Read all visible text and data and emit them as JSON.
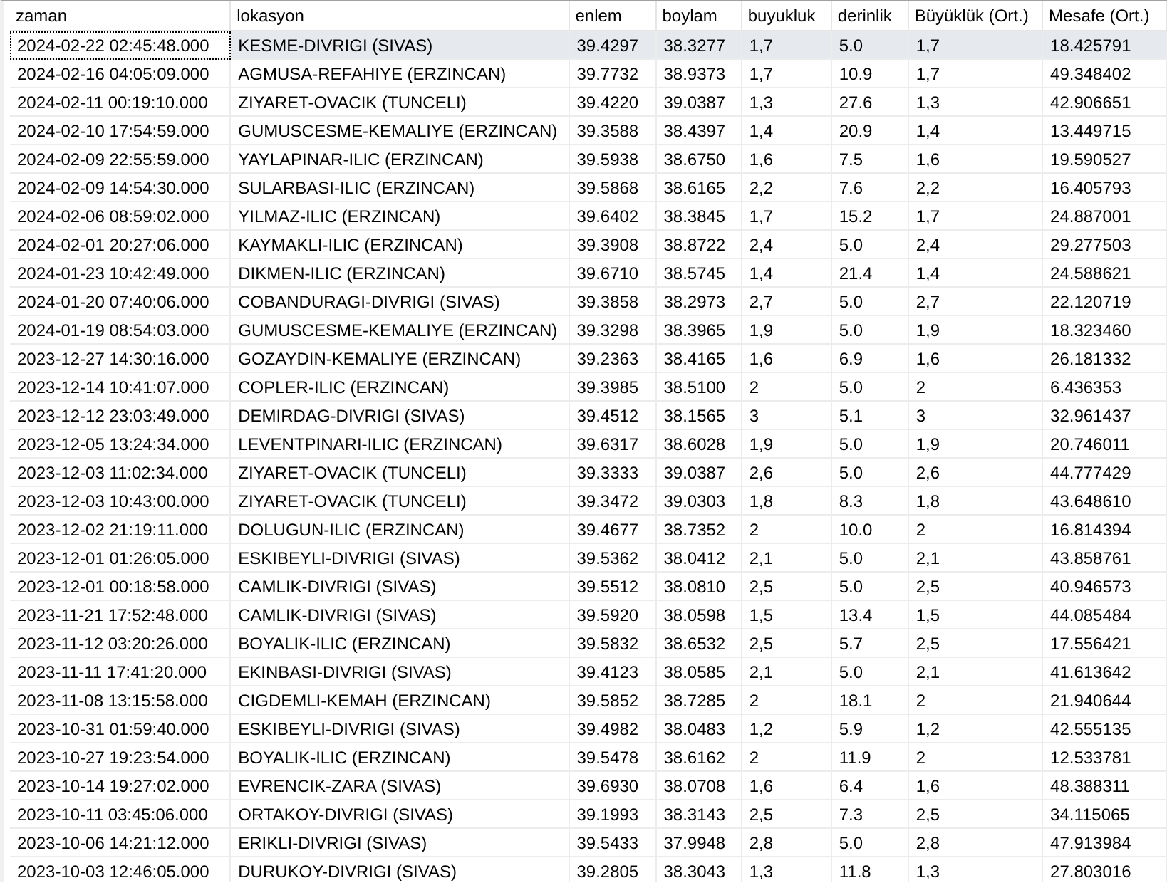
{
  "table": {
    "columns": [
      "zaman",
      "lokasyon",
      "enlem",
      "boylam",
      "buyukluk",
      "derinlik",
      "Büyüklük (Ort.)",
      "Mesafe (Ort.)"
    ],
    "rows": [
      {
        "selected": true,
        "cells": [
          "2024-02-22 02:45:48.000",
          "KESME-DIVRIGI (SIVAS)",
          "39.4297",
          "38.3277",
          "1,7",
          "5.0",
          "1,7",
          "18.425791"
        ]
      },
      {
        "selected": false,
        "cells": [
          "2024-02-16 04:05:09.000",
          "AGMUSA-REFAHIYE (ERZINCAN)",
          "39.7732",
          "38.9373",
          "1,7",
          "10.9",
          "1,7",
          "49.348402"
        ]
      },
      {
        "selected": false,
        "cells": [
          "2024-02-11 00:19:10.000",
          "ZIYARET-OVACIK (TUNCELI)",
          "39.4220",
          "39.0387",
          "1,3",
          "27.6",
          "1,3",
          "42.906651"
        ]
      },
      {
        "selected": false,
        "cells": [
          "2024-02-10 17:54:59.000",
          "GUMUSCESME-KEMALIYE (ERZINCAN)",
          "39.3588",
          "38.4397",
          "1,4",
          "20.9",
          "1,4",
          "13.449715"
        ]
      },
      {
        "selected": false,
        "cells": [
          "2024-02-09 22:55:59.000",
          "YAYLAPINAR-ILIC (ERZINCAN)",
          "39.5938",
          "38.6750",
          "1,6",
          "7.5",
          "1,6",
          "19.590527"
        ]
      },
      {
        "selected": false,
        "cells": [
          "2024-02-09 14:54:30.000",
          "SULARBASI-ILIC (ERZINCAN)",
          "39.5868",
          "38.6165",
          "2,2",
          "7.6",
          "2,2",
          "16.405793"
        ]
      },
      {
        "selected": false,
        "cells": [
          "2024-02-06 08:59:02.000",
          "YILMAZ-ILIC (ERZINCAN)",
          "39.6402",
          "38.3845",
          "1,7",
          "15.2",
          "1,7",
          "24.887001"
        ]
      },
      {
        "selected": false,
        "cells": [
          "2024-02-01 20:27:06.000",
          "KAYMAKLI-ILIC (ERZINCAN)",
          "39.3908",
          "38.8722",
          "2,4",
          "5.0",
          "2,4",
          "29.277503"
        ]
      },
      {
        "selected": false,
        "cells": [
          "2024-01-23 10:42:49.000",
          "DIKMEN-ILIC (ERZINCAN)",
          "39.6710",
          "38.5745",
          "1,4",
          "21.4",
          "1,4",
          "24.588621"
        ]
      },
      {
        "selected": false,
        "cells": [
          "2024-01-20 07:40:06.000",
          "COBANDURAGI-DIVRIGI (SIVAS)",
          "39.3858",
          "38.2973",
          "2,7",
          "5.0",
          "2,7",
          "22.120719"
        ]
      },
      {
        "selected": false,
        "cells": [
          "2024-01-19 08:54:03.000",
          "GUMUSCESME-KEMALIYE (ERZINCAN)",
          "39.3298",
          "38.3965",
          "1,9",
          "5.0",
          "1,9",
          "18.323460"
        ]
      },
      {
        "selected": false,
        "cells": [
          "2023-12-27 14:30:16.000",
          "GOZAYDIN-KEMALIYE (ERZINCAN)",
          "39.2363",
          "38.4165",
          "1,6",
          "6.9",
          "1,6",
          "26.181332"
        ]
      },
      {
        "selected": false,
        "cells": [
          "2023-12-14 10:41:07.000",
          "COPLER-ILIC (ERZINCAN)",
          "39.3985",
          "38.5100",
          "2",
          "5.0",
          "2",
          "6.436353"
        ]
      },
      {
        "selected": false,
        "cells": [
          "2023-12-12 23:03:49.000",
          "DEMIRDAG-DIVRIGI (SIVAS)",
          "39.4512",
          "38.1565",
          "3",
          "5.1",
          "3",
          "32.961437"
        ]
      },
      {
        "selected": false,
        "cells": [
          "2023-12-05 13:24:34.000",
          "LEVENTPINARI-ILIC (ERZINCAN)",
          "39.6317",
          "38.6028",
          "1,9",
          "5.0",
          "1,9",
          "20.746011"
        ]
      },
      {
        "selected": false,
        "cells": [
          "2023-12-03 11:02:34.000",
          "ZIYARET-OVACIK (TUNCELI)",
          "39.3333",
          "39.0387",
          "2,6",
          "5.0",
          "2,6",
          "44.777429"
        ]
      },
      {
        "selected": false,
        "cells": [
          "2023-12-03 10:43:00.000",
          "ZIYARET-OVACIK (TUNCELI)",
          "39.3472",
          "39.0303",
          "1,8",
          "8.3",
          "1,8",
          "43.648610"
        ]
      },
      {
        "selected": false,
        "cells": [
          "2023-12-02 21:19:11.000",
          "DOLUGUN-ILIC (ERZINCAN)",
          "39.4677",
          "38.7352",
          "2",
          "10.0",
          "2",
          "16.814394"
        ]
      },
      {
        "selected": false,
        "cells": [
          "2023-12-01 01:26:05.000",
          "ESKIBEYLI-DIVRIGI (SIVAS)",
          "39.5362",
          "38.0412",
          "2,1",
          "5.0",
          "2,1",
          "43.858761"
        ]
      },
      {
        "selected": false,
        "cells": [
          "2023-12-01 00:18:58.000",
          "CAMLIK-DIVRIGI (SIVAS)",
          "39.5512",
          "38.0810",
          "2,5",
          "5.0",
          "2,5",
          "40.946573"
        ]
      },
      {
        "selected": false,
        "cells": [
          "2023-11-21 17:52:48.000",
          "CAMLIK-DIVRIGI (SIVAS)",
          "39.5920",
          "38.0598",
          "1,5",
          "13.4",
          "1,5",
          "44.085484"
        ]
      },
      {
        "selected": false,
        "cells": [
          "2023-11-12 03:20:26.000",
          "BOYALIK-ILIC (ERZINCAN)",
          "39.5832",
          "38.6532",
          "2,5",
          "5.7",
          "2,5",
          "17.556421"
        ]
      },
      {
        "selected": false,
        "cells": [
          "2023-11-11 17:41:20.000",
          "EKINBASI-DIVRIGI (SIVAS)",
          "39.4123",
          "38.0585",
          "2,1",
          "5.0",
          "2,1",
          "41.613642"
        ]
      },
      {
        "selected": false,
        "cells": [
          "2023-11-08 13:15:58.000",
          "CIGDEMLI-KEMAH (ERZINCAN)",
          "39.5852",
          "38.7285",
          "2",
          "18.1",
          "2",
          "21.940644"
        ]
      },
      {
        "selected": false,
        "cells": [
          "2023-10-31 01:59:40.000",
          "ESKIBEYLI-DIVRIGI (SIVAS)",
          "39.4982",
          "38.0483",
          "1,2",
          "5.9",
          "1,2",
          "42.555135"
        ]
      },
      {
        "selected": false,
        "cells": [
          "2023-10-27 19:23:54.000",
          "BOYALIK-ILIC (ERZINCAN)",
          "39.5478",
          "38.6162",
          "2",
          "11.9",
          "2",
          "12.533781"
        ]
      },
      {
        "selected": false,
        "cells": [
          "2023-10-14 19:27:02.000",
          "EVRENCIK-ZARA (SIVAS)",
          "39.6930",
          "38.0708",
          "1,6",
          "6.4",
          "1,6",
          "48.388311"
        ]
      },
      {
        "selected": false,
        "cells": [
          "2023-10-11 03:45:06.000",
          "ORTAKOY-DIVRIGI (SIVAS)",
          "39.1993",
          "38.3143",
          "2,5",
          "7.3",
          "2,5",
          "34.115065"
        ]
      },
      {
        "selected": false,
        "cells": [
          "2023-10-06 14:21:12.000",
          "ERIKLI-DIVRIGI (SIVAS)",
          "39.5433",
          "37.9948",
          "2,8",
          "5.0",
          "2,8",
          "47.913984"
        ]
      },
      {
        "selected": false,
        "cells": [
          "2023-10-03 12:46:05.000",
          "DURUKOY-DIVRIGI (SIVAS)",
          "39.2805",
          "38.3043",
          "1,3",
          "11.8",
          "1,3",
          "27.803016"
        ]
      }
    ]
  }
}
